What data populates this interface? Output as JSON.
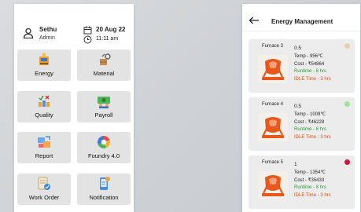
{
  "dashboard": {
    "user_name": "Sethu",
    "user_role": "Admin",
    "date": "20 Aug 22",
    "time": "11:11 am",
    "tiles": [
      {
        "label": "Energy",
        "icon": "energy-icon"
      },
      {
        "label": "Material",
        "icon": "material-icon"
      },
      {
        "label": "Quality",
        "icon": "quality-icon"
      },
      {
        "label": "Payroll",
        "icon": "payroll-icon"
      },
      {
        "label": "Report",
        "icon": "report-icon"
      },
      {
        "label": "Foundry 4.0",
        "icon": "foundry-icon"
      },
      {
        "label": "Work Order",
        "icon": "work-order-icon"
      },
      {
        "label": "Notification",
        "icon": "notification-icon"
      }
    ]
  },
  "energy": {
    "title": "Energy Management",
    "furnaces": [
      {
        "name": "Furnace 3",
        "value": "0.5",
        "temp": "Temp - 956℃",
        "cost": "Cost - ₹54864",
        "runtime": "Runtime - 8 hrs",
        "idle": "IDLE Time - 3 hrs",
        "status_color": "#e9cdb2"
      },
      {
        "name": "Furnace 4",
        "value": "0.5",
        "temp": "Temp - 1009℃",
        "cost": "Cost - ₹46228",
        "runtime": "Runtime - 8 hrs",
        "idle": "IDLE Time - 3 hrs",
        "status_color": "#9be39b"
      },
      {
        "name": "Furnace 5",
        "value": "1",
        "temp": "Temp - 1354℃",
        "cost": "Cost - ₹35433",
        "runtime": "Runtime - 8 hrs",
        "idle": "IDLE Time - 3 hrs",
        "status_color": "#d0183a"
      }
    ]
  },
  "colors": {
    "furnace_orange": "#e8571b",
    "runtime_green": "#2c9c3a",
    "idle_orange": "#d0531c"
  }
}
